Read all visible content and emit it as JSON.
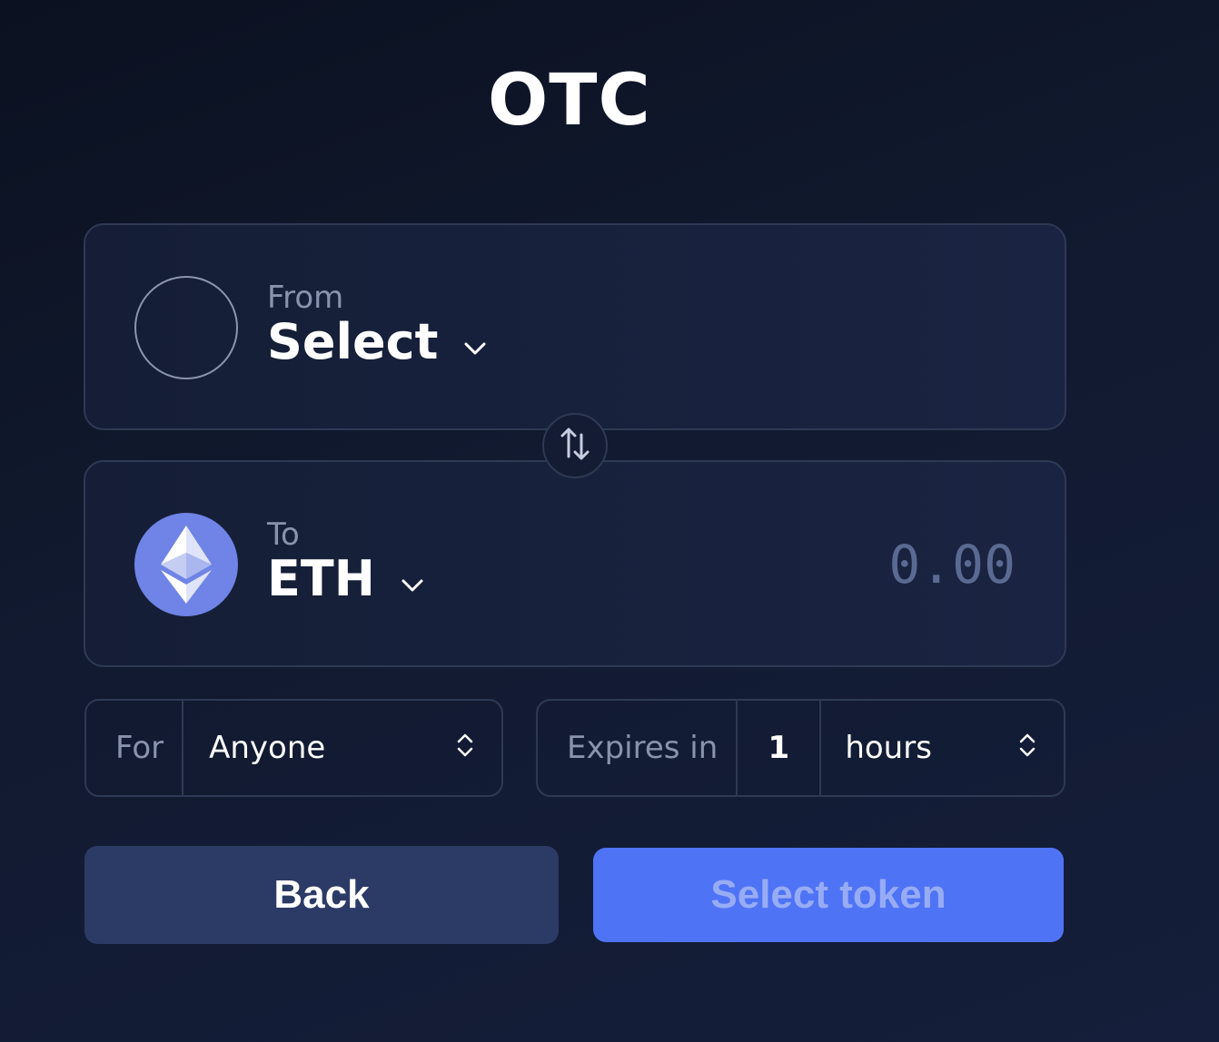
{
  "page_title": "OTC",
  "from_panel": {
    "label": "From",
    "token": "Select"
  },
  "to_panel": {
    "label": "To",
    "token": "ETH",
    "amount_placeholder": "0.00"
  },
  "for_field": {
    "label": "For",
    "value": "Anyone"
  },
  "expires_field": {
    "label": "Expires in",
    "amount": "1",
    "unit": "hours"
  },
  "buttons": {
    "back": "Back",
    "select_token": "Select token"
  },
  "icons": {
    "swap": "swap-arrows-icon",
    "chevron": "chevron-down-icon",
    "stepper": "up-down-chevron-icon",
    "eth": "ethereum-icon"
  },
  "colors": {
    "accent": "#4f73f5",
    "eth": "#6f84e6",
    "back_button": "#2c3a66"
  }
}
